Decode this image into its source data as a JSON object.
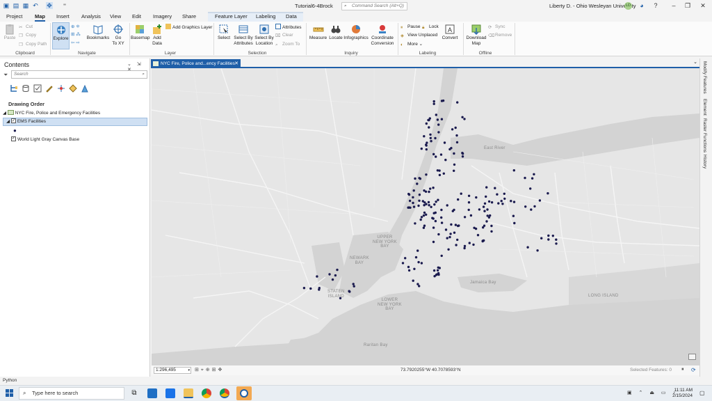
{
  "titlebar": {
    "app_title": "Tutorial6-4Brock",
    "command_search_placeholder": "Command Search (Alt+Q)",
    "user_name": "Liberty D. - Ohio Wesleyan University",
    "user_initials": "LD"
  },
  "tabs": [
    "Project",
    "Map",
    "Insert",
    "Analysis",
    "View",
    "Edit",
    "Imagery",
    "Share",
    "Feature Layer",
    "Labeling",
    "Data"
  ],
  "active_tab": "Map",
  "ribbon": {
    "clipboard": {
      "paste": "Paste",
      "cut": "Cut",
      "copy": "Copy",
      "copy_path": "Copy Path",
      "label": "Clipboard"
    },
    "navigate": {
      "explore": "Explore",
      "bookmarks": "Bookmarks",
      "goto_xy_1": "Go",
      "goto_xy_2": "To XY",
      "label": "Navigate"
    },
    "layer": {
      "basemap": "Basemap",
      "add_data_1": "Add",
      "add_data_2": "Data",
      "add_graphics": "Add Graphics Layer",
      "label": "Layer"
    },
    "selection": {
      "select": "Select",
      "by_attr_1": "Select By",
      "by_attr_2": "Attributes",
      "by_loc_1": "Select By",
      "by_loc_2": "Location",
      "attributes": "Attributes",
      "clear": "Clear",
      "zoom_to": "Zoom To",
      "label": "Selection"
    },
    "inquiry": {
      "measure": "Measure",
      "locate": "Locate",
      "infographics": "Infographics",
      "coord_1": "Coordinate",
      "coord_2": "Conversion",
      "label": "Inquiry"
    },
    "labeling": {
      "pause": "Pause",
      "lock": "Lock",
      "view_unplaced": "View Unplaced",
      "more": "More",
      "convert": "Convert",
      "label": "Labeling"
    },
    "offline": {
      "download_1": "Download",
      "download_2": "Map",
      "sync": "Sync",
      "remove": "Remove",
      "label": "Offline"
    }
  },
  "contents": {
    "title": "Contents",
    "search_placeholder": "Search",
    "drawing_order": "Drawing Order",
    "map_name": "NYC Fire, Police and Emergency Facilities",
    "layers": [
      {
        "name": "EMS Facilities",
        "checked": true,
        "selected": true
      },
      {
        "name": "World Light Gray Canvas Base",
        "checked": true,
        "selected": false
      }
    ]
  },
  "map_view": {
    "tab_label": "NYC Fire, Police and...ency Facilities",
    "labels": {
      "upper_bay_1": "UPPER",
      "upper_bay_2": "NEW YORK",
      "upper_bay_3": "BAY",
      "newark_bay_1": "NEWARK",
      "newark_bay_2": "BAY",
      "staten_1": "STATEN",
      "staten_2": "ISLAND",
      "lower_bay_1": "LOWER",
      "lower_bay_2": "NEW YORK",
      "lower_bay_3": "BAY",
      "raritan": "Raritan Bay",
      "long_island": "LONG ISLAND",
      "east_river": "East River",
      "jamaica_bay": "Jamaica Bay"
    },
    "point_color": "#1a1a4e",
    "water_color": "#d2d2d2",
    "land_color": "#e9e9e9"
  },
  "status_bar": {
    "scale": "1:296,495",
    "coordinates": "73.7920255°W 40.7078593°N",
    "selected_features": "Selected Features: 0"
  },
  "right_dock": [
    "Modify Features",
    "Element",
    "Raster Functions",
    "History"
  ],
  "python_label": "Python",
  "taskbar": {
    "search_placeholder": "Type here to search",
    "time": "11:11 AM",
    "date": "2/15/2024"
  }
}
